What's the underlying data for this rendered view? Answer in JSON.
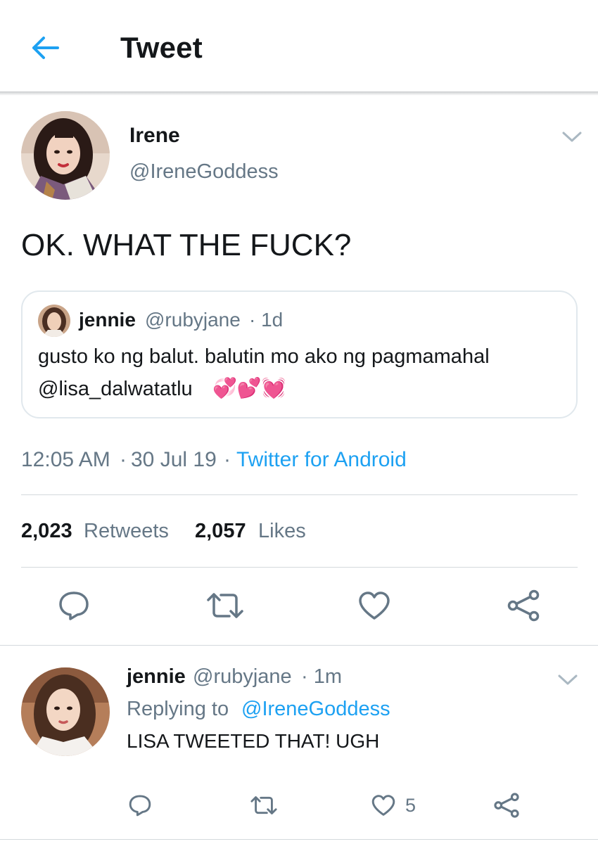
{
  "header": {
    "title": "Tweet",
    "back_icon": "arrow-left-icon"
  },
  "tweet": {
    "name": "Irene",
    "handle": "@IreneGoddess",
    "text": "OK. WHAT THE FUCK?",
    "time": "12:05 AM",
    "sep1": "·",
    "date": "30 Jul 19",
    "sep2": "·",
    "source": "Twitter for Android",
    "retweets_count": "2,023",
    "retweets_label": "Retweets",
    "likes_count": "2,057",
    "likes_label": "Likes"
  },
  "quoted": {
    "name": "jennie",
    "handle": "@rubyjane",
    "age": "· 1d",
    "line1": "gusto ko ng balut. balutin mo ako ng pagmamahal",
    "line2": "@lisa_dalwatatlu",
    "emoji": "💞💕💓"
  },
  "reply": {
    "name": "jennie",
    "handle": "@rubyjane",
    "age": "· 1m",
    "replying_prefix": "Replying to",
    "replying_to": "@IreneGoddess",
    "text": "LISA TWEETED THAT! UGH",
    "like_count": "5"
  },
  "colors": {
    "accent": "#1da1f2",
    "muted": "#657786",
    "text": "#14171a",
    "divider": "#e1e8ed",
    "emoji_pink": "#e0457b"
  },
  "icons": [
    "arrow-left-icon",
    "chevron-down-icon",
    "reply-icon",
    "retweet-icon",
    "heart-icon",
    "share-icon"
  ]
}
